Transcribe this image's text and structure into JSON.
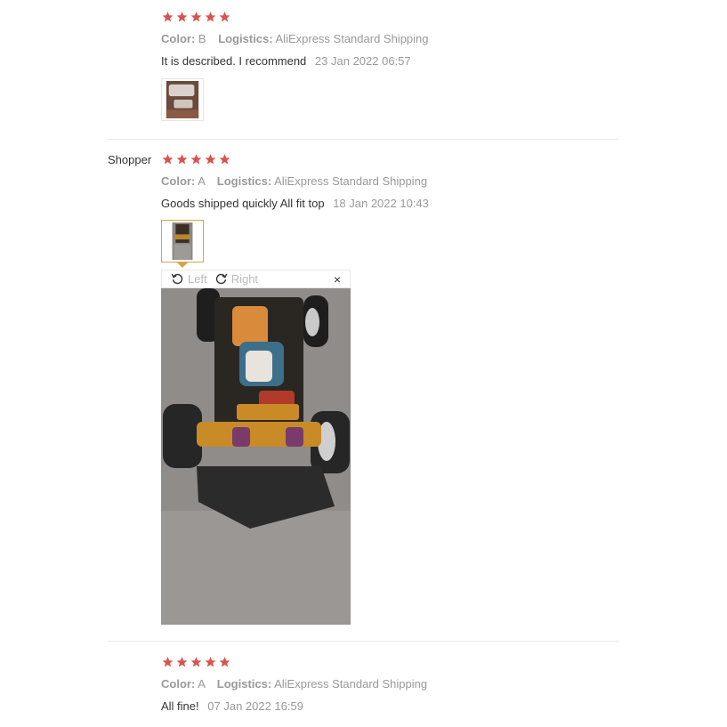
{
  "reviews": [
    {
      "author": "",
      "stars": 5,
      "color_key": "Color:",
      "color_val": "B",
      "logistics_key": "Logistics:",
      "logistics_val": "AliExpress Standard Shipping",
      "text": "It is described. I recommend",
      "date": "23 Jan 2022 06:57"
    },
    {
      "author": "Shopper",
      "stars": 5,
      "color_key": "Color:",
      "color_val": "A",
      "logistics_key": "Logistics:",
      "logistics_val": "AliExpress Standard Shipping",
      "text": "Goods shipped quickly All fit top",
      "date": "18 Jan 2022 10:43"
    },
    {
      "author": "",
      "stars": 5,
      "color_key": "Color:",
      "color_val": "A",
      "logistics_key": "Logistics:",
      "logistics_val": "AliExpress Standard Shipping",
      "text": "All fine!",
      "date": "07 Jan 2022 16:59"
    }
  ],
  "viewer": {
    "left_label": "Left",
    "right_label": "Right",
    "close_label": "×"
  },
  "icons": {
    "star": "star-icon",
    "rotate_left": "rotate-left-icon",
    "rotate_right": "rotate-right-icon",
    "close": "close-icon"
  },
  "colors": {
    "star": "#d9534f",
    "active_border": "#d9a441",
    "meta": "#999999",
    "text": "#333333"
  }
}
